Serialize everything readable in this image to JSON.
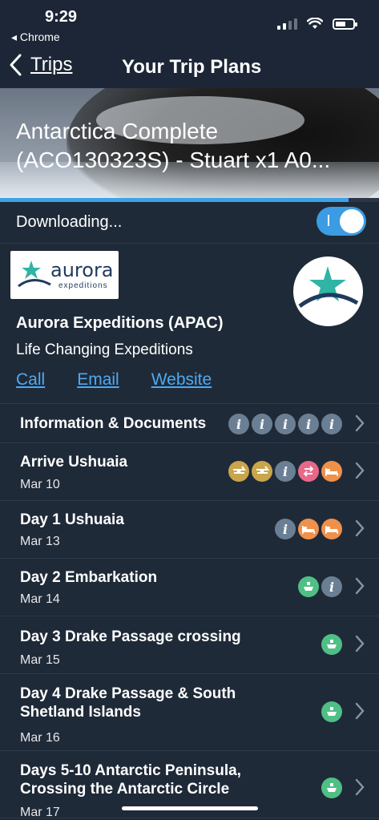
{
  "status_bar": {
    "time": "9:29",
    "back_app": "◂ Chrome"
  },
  "nav": {
    "back_label": "Trips",
    "title": "Your Trip Plans"
  },
  "trip": {
    "title_line1": "Antarctica Complete",
    "title_line2": "(ACO130323S) - Stuart x1 A0..."
  },
  "download": {
    "label": "Downloading...",
    "progress": 0.92,
    "toggle_on": true
  },
  "company": {
    "logo_word": "aurora",
    "logo_sub": "expeditions",
    "name": "Aurora Expeditions (APAC)",
    "tagline": "Life Changing Expeditions",
    "links": {
      "call": "Call",
      "email": "Email",
      "website": "Website"
    }
  },
  "items": [
    {
      "title": "Information & Documents",
      "date": "",
      "icons": [
        "info",
        "info",
        "info",
        "info",
        "info"
      ]
    },
    {
      "title": "Arrive Ushuaia",
      "date": "Mar 10",
      "icons": [
        "plane",
        "plane",
        "info",
        "transfer",
        "hotel"
      ]
    },
    {
      "title": "Day 1 Ushuaia",
      "date": "Mar 13",
      "icons": [
        "info",
        "hotel",
        "hotel"
      ]
    },
    {
      "title": "Day 2 Embarkation",
      "date": "Mar 14",
      "icons": [
        "ship",
        "info"
      ]
    },
    {
      "title": "Day 3 Drake Passage crossing",
      "date": "Mar 15",
      "icons": [
        "ship"
      ]
    },
    {
      "title": "Day 4 Drake Passage & South Shetland Islands",
      "date": "Mar 16",
      "icons": [
        "ship"
      ]
    },
    {
      "title": "Days 5-10 Antarctic Peninsula, Crossing the Antarctic Circle",
      "date": "Mar 17",
      "icons": [
        "ship"
      ]
    }
  ],
  "colors": {
    "background": "#1f2a38",
    "accent": "#3b9ce3",
    "link": "#4ea9f0",
    "info_icon": "#6b7f94",
    "plane_icon": "#c9a54b",
    "transfer_icon": "#e9688a",
    "hotel_icon": "#f0914b",
    "ship_icon": "#4fbf85"
  }
}
